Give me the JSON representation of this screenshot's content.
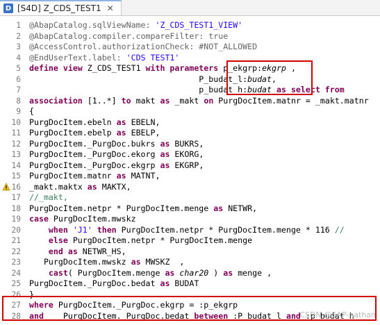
{
  "tab": {
    "icon_letter": "D",
    "title": "[S4D] Z_CDS_TEST1",
    "close": "✕"
  },
  "lines": [
    {
      "n": "1",
      "segs": [
        [
          "ann",
          "@AbapCatalog.sqlViewName: "
        ],
        [
          "str",
          "'Z_CDS_TEST1_VIEW'"
        ]
      ]
    },
    {
      "n": "2",
      "segs": [
        [
          "ann",
          "@AbapCatalog.compiler.compareFilter: true"
        ]
      ]
    },
    {
      "n": "3",
      "segs": [
        [
          "ann",
          "@AccessControl.authorizationCheck: #NOT_ALLOWED"
        ]
      ]
    },
    {
      "n": "4",
      "segs": [
        [
          "ann",
          "@EndUserText.label: "
        ],
        [
          "str",
          "'CDS TEST1'"
        ]
      ]
    },
    {
      "n": "5",
      "segs": [
        [
          "kw",
          "define view "
        ],
        [
          "",
          "Z_CDS_TEST1 "
        ],
        [
          "kw",
          "with parameters "
        ],
        [
          "",
          "p_ekgrp:"
        ],
        [
          "it",
          "ekgrp"
        ],
        [
          "",
          " ,"
        ]
      ]
    },
    {
      "n": "6",
      "segs": [
        [
          "",
          "                                   P_budat_l:"
        ],
        [
          "it",
          "budat"
        ],
        [
          ","
        ]
      ]
    },
    {
      "n": "7",
      "segs": [
        [
          "",
          "                                   p_budat_h:"
        ],
        [
          "it",
          "budat"
        ],
        [
          "",
          " "
        ],
        [
          "kw",
          "as select from"
        ]
      ]
    },
    {
      "n": "8",
      "segs": [
        [
          "kw",
          "association "
        ],
        [
          "",
          "[1..*] "
        ],
        [
          "kw",
          "to "
        ],
        [
          "",
          "makt "
        ],
        [
          "kw",
          "as "
        ],
        [
          "",
          "_makt "
        ],
        [
          "kw",
          "on "
        ],
        [
          "",
          "PurgDocItem.matnr = _makt.matnr"
        ]
      ]
    },
    {
      "n": "9",
      "segs": [
        [
          "",
          "{"
        ]
      ]
    },
    {
      "n": "10",
      "segs": [
        [
          "",
          "PurgDocItem.ebeln "
        ],
        [
          "kw",
          "as "
        ],
        [
          "",
          "EBELN,"
        ]
      ]
    },
    {
      "n": "11",
      "segs": [
        [
          "",
          "PurgDocItem.ebelp "
        ],
        [
          "kw",
          "as "
        ],
        [
          "",
          "EBELP,"
        ]
      ]
    },
    {
      "n": "12",
      "segs": [
        [
          "",
          "PurgDocItem._PurgDoc.bukrs "
        ],
        [
          "kw",
          "as "
        ],
        [
          "",
          "BUKRS,"
        ]
      ]
    },
    {
      "n": "13",
      "segs": [
        [
          "",
          "PurgDocItem._PurgDoc.ekorg "
        ],
        [
          "kw",
          "as "
        ],
        [
          "",
          "EKORG,"
        ]
      ]
    },
    {
      "n": "14",
      "segs": [
        [
          "",
          "PurgDocItem._PurgDoc.ekgrp "
        ],
        [
          "kw",
          "as "
        ],
        [
          "",
          "EKGRP,"
        ]
      ]
    },
    {
      "n": "15",
      "segs": [
        [
          "",
          "PurgDocItem.matnr "
        ],
        [
          "kw",
          "as "
        ],
        [
          "",
          "MATNT,"
        ]
      ]
    },
    {
      "n": "16",
      "warn": true,
      "segs": [
        [
          "",
          "_makt.maktx "
        ],
        [
          "kw",
          "as "
        ],
        [
          "",
          "MAKTX,"
        ]
      ]
    },
    {
      "n": "17",
      "segs": [
        [
          "cmt",
          "//_makt,"
        ]
      ]
    },
    {
      "n": "18",
      "segs": [
        [
          "",
          "PurgDocItem.netpr * PurgDocItem.menge "
        ],
        [
          "kw",
          "as "
        ],
        [
          "",
          "NETWR,"
        ]
      ]
    },
    {
      "n": "19",
      "segs": [
        [
          "kw",
          "case "
        ],
        [
          "",
          "PurgDocItem.mwskz"
        ]
      ]
    },
    {
      "n": "20",
      "segs": [
        [
          "",
          "    "
        ],
        [
          "kw",
          "when "
        ],
        [
          "str",
          "'J1' "
        ],
        [
          "kw",
          "then "
        ],
        [
          "",
          "PurgDocItem.netpr * PurgDocItem.menge * 116 "
        ],
        [
          "cmt",
          "//"
        ]
      ]
    },
    {
      "n": "21",
      "segs": [
        [
          "",
          "    "
        ],
        [
          "kw",
          "else "
        ],
        [
          "",
          "PurgDocItem.netpr * PurgDocItem.menge"
        ]
      ]
    },
    {
      "n": "22",
      "segs": [
        [
          "",
          "    "
        ],
        [
          "kw",
          "end as "
        ],
        [
          "",
          "NETWR_HS,"
        ]
      ]
    },
    {
      "n": "23",
      "segs": [
        [
          "",
          "   PurgDocItem.mwskz "
        ],
        [
          "kw",
          "as "
        ],
        [
          "",
          "MWSKZ  ,"
        ]
      ]
    },
    {
      "n": "24",
      "segs": [
        [
          "",
          "    "
        ],
        [
          "kw",
          "cast"
        ],
        [
          "",
          "( PurgDocItem.menge "
        ],
        [
          "kw",
          "as "
        ],
        [
          "it",
          "char20"
        ],
        [
          "",
          " ) "
        ],
        [
          "kw",
          "as "
        ],
        [
          "",
          "menge ,"
        ]
      ]
    },
    {
      "n": "25",
      "segs": [
        [
          "",
          "PurgDocItem._PurgDoc.bedat "
        ],
        [
          "kw",
          "as "
        ],
        [
          "",
          "BUDAT"
        ]
      ]
    },
    {
      "n": "26",
      "segs": [
        [
          "",
          "}"
        ]
      ]
    },
    {
      "n": "27",
      "segs": [
        [
          "kw",
          "where "
        ],
        [
          "",
          "PurgDocItem._PurgDoc.ekgrp = :p_ekgrp"
        ]
      ]
    },
    {
      "n": "28",
      "segs": [
        [
          "kw",
          "and    "
        ],
        [
          "",
          "PurgDocItem._PurgDoc.bedat "
        ],
        [
          "kw",
          "between "
        ],
        [
          "",
          ":P_budat_l "
        ],
        [
          "kw",
          "and "
        ],
        [
          "",
          ":p_budat_h"
        ]
      ]
    }
  ],
  "watermark": "CSDN @SAP-nathan"
}
